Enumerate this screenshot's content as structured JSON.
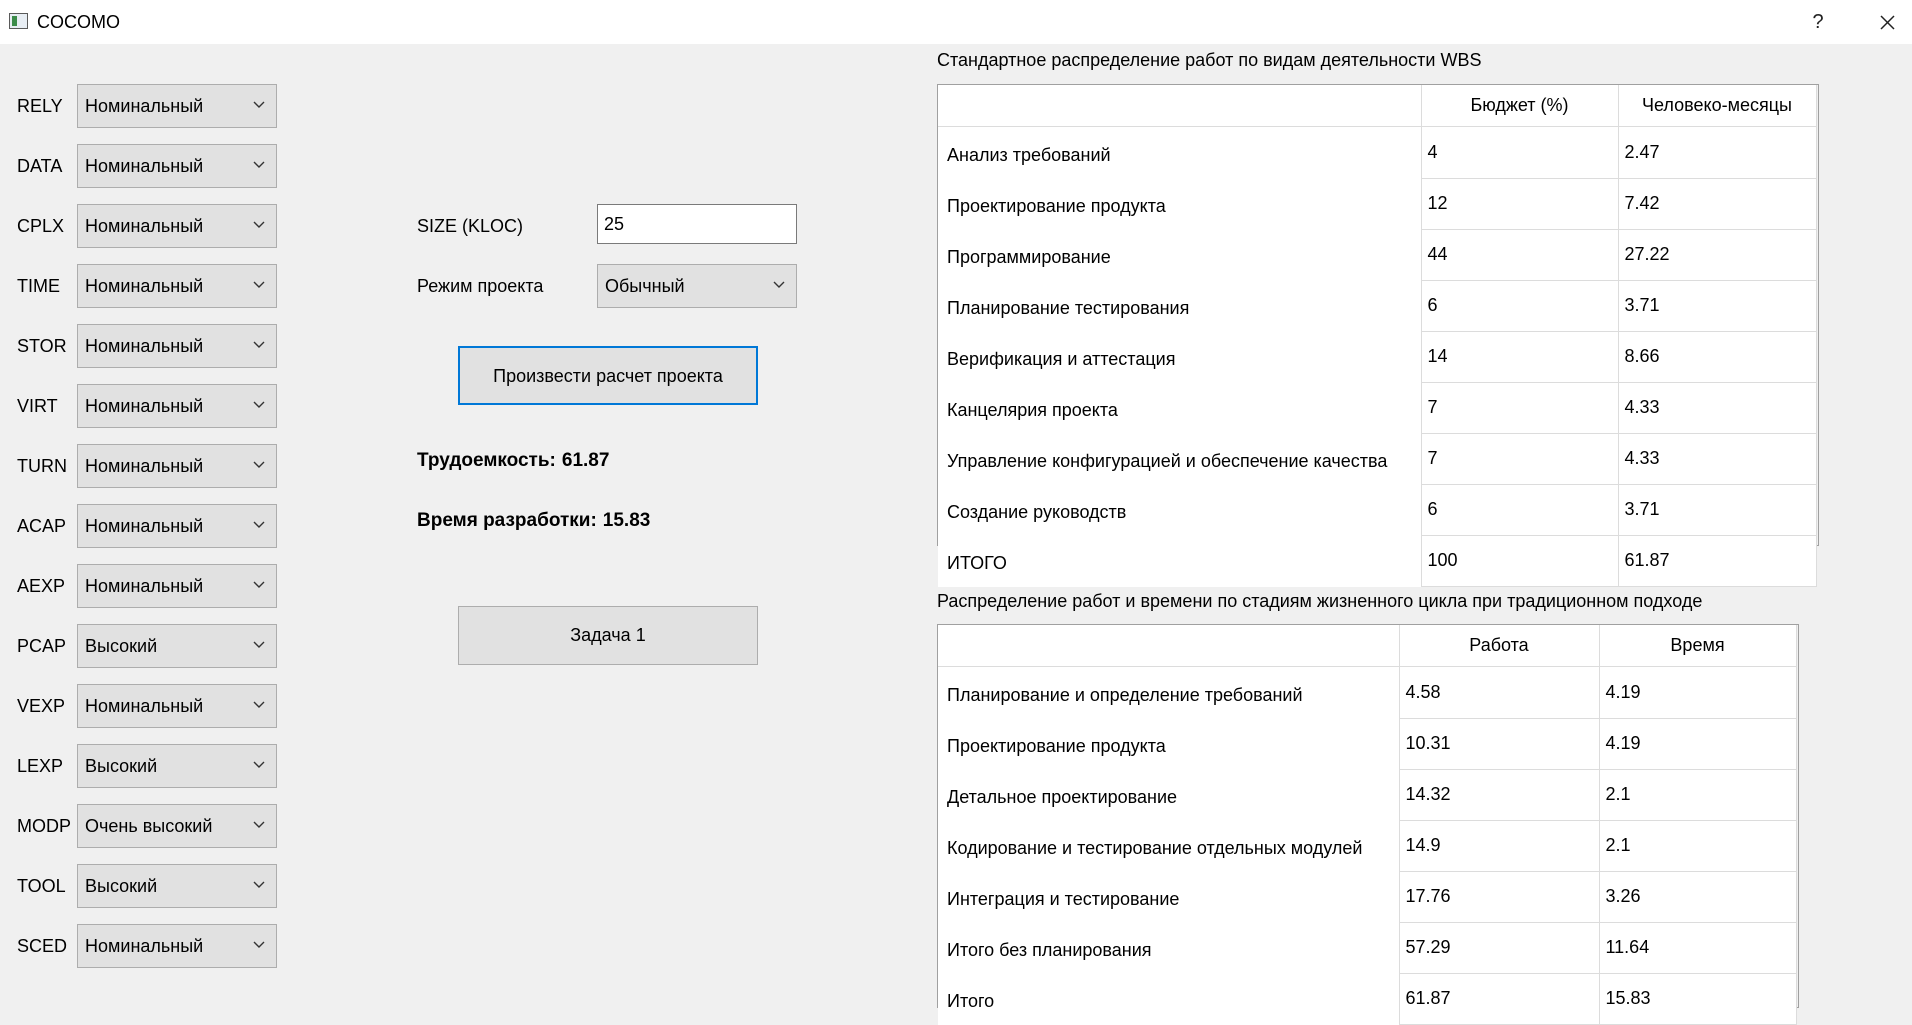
{
  "window": {
    "title": "COCOMO",
    "help_label": "?"
  },
  "params": [
    {
      "label": "RELY",
      "value": "Номинальный"
    },
    {
      "label": "DATA",
      "value": "Номинальный"
    },
    {
      "label": "CPLX",
      "value": "Номинальный"
    },
    {
      "label": "TIME",
      "value": "Номинальный"
    },
    {
      "label": "STOR",
      "value": "Номинальный"
    },
    {
      "label": "VIRT",
      "value": "Номинальный"
    },
    {
      "label": "TURN",
      "value": "Номинальный"
    },
    {
      "label": "ACAP",
      "value": "Номинальный"
    },
    {
      "label": "AEXP",
      "value": "Номинальный"
    },
    {
      "label": "PCAP",
      "value": "Высокий"
    },
    {
      "label": "VEXP",
      "value": "Номинальный"
    },
    {
      "label": "LEXP",
      "value": "Высокий"
    },
    {
      "label": "MODP",
      "value": "Очень высокий"
    },
    {
      "label": "TOOL",
      "value": "Высокий"
    },
    {
      "label": "SCED",
      "value": "Номинальный"
    }
  ],
  "size": {
    "label": "SIZE (KLOC)",
    "value": "25"
  },
  "mode": {
    "label": "Режим проекта",
    "value": "Обычный"
  },
  "actions": {
    "calculate_label": "Произвести расчет проекта",
    "task_label": "Задача 1"
  },
  "results": {
    "effort_label": "Трудоемкость:",
    "effort_value": "61.87",
    "time_label": "Время разработки:",
    "time_value": "15.83"
  },
  "wbs_table": {
    "title": "Стандартное распределение работ по видам деятельности WBS",
    "columns": [
      "Бюджет (%)",
      "Человеко-месяцы"
    ],
    "rows": [
      {
        "name": "Анализ требований",
        "values": [
          "4",
          "2.47"
        ]
      },
      {
        "name": "Проектирование продукта",
        "values": [
          "12",
          "7.42"
        ]
      },
      {
        "name": "Программирование",
        "values": [
          "44",
          "27.22"
        ]
      },
      {
        "name": "Планирование тестирования",
        "values": [
          "6",
          "3.71"
        ]
      },
      {
        "name": "Верификация и аттестация",
        "values": [
          "14",
          "8.66"
        ]
      },
      {
        "name": "Канцелярия проекта",
        "values": [
          "7",
          "4.33"
        ]
      },
      {
        "name": "Управление конфигурацией и обеспечение качества",
        "values": [
          "7",
          "4.33"
        ]
      },
      {
        "name": "Создание руководств",
        "values": [
          "6",
          "3.71"
        ]
      },
      {
        "name": "ИТОГО",
        "values": [
          "100",
          "61.87"
        ]
      }
    ]
  },
  "lifecycle_table": {
    "title": "Распределение работ и времени по стадиям жизненного цикла при традиционном подходе",
    "columns": [
      "Работа",
      "Время"
    ],
    "rows": [
      {
        "name": "Планирование и определение требований",
        "values": [
          "4.58",
          "4.19"
        ]
      },
      {
        "name": "Проектирование продукта",
        "values": [
          "10.31",
          "4.19"
        ]
      },
      {
        "name": "Детальное проектирование",
        "values": [
          "14.32",
          "2.1"
        ]
      },
      {
        "name": "Кодирование и тестирование отдельных модулей",
        "values": [
          "14.9",
          "2.1"
        ]
      },
      {
        "name": "Интеграция и тестирование",
        "values": [
          "17.76",
          "3.26"
        ]
      },
      {
        "name": "Итого без планирования",
        "values": [
          "57.29",
          "11.64"
        ]
      },
      {
        "name": "Итого",
        "values": [
          "61.87",
          "15.83"
        ]
      }
    ]
  }
}
